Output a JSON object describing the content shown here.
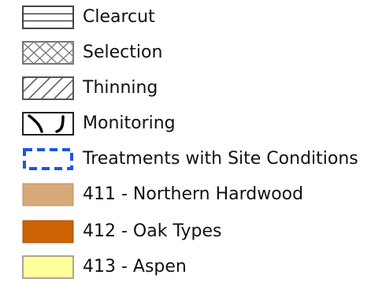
{
  "legend": {
    "items": [
      {
        "label": "Clearcut",
        "symbol": "horizontal-lines-swatch"
      },
      {
        "label": "Selection",
        "symbol": "crosshatch-swatch"
      },
      {
        "label": "Thinning",
        "symbol": "diagonal-hatch-swatch"
      },
      {
        "label": "Monitoring",
        "symbol": "brackets-swatch"
      },
      {
        "label": "Treatments with Site Conditions",
        "symbol": "dashed-outline-swatch",
        "color": "#1a56e0"
      },
      {
        "label": "411 - Northern Hardwood",
        "symbol": "fill-swatch",
        "color": "#d8a978"
      },
      {
        "label": "412 - Oak Types",
        "symbol": "fill-swatch",
        "color": "#cc6204"
      },
      {
        "label": "413 - Aspen",
        "symbol": "fill-swatch",
        "color": "#ffff99"
      }
    ]
  }
}
